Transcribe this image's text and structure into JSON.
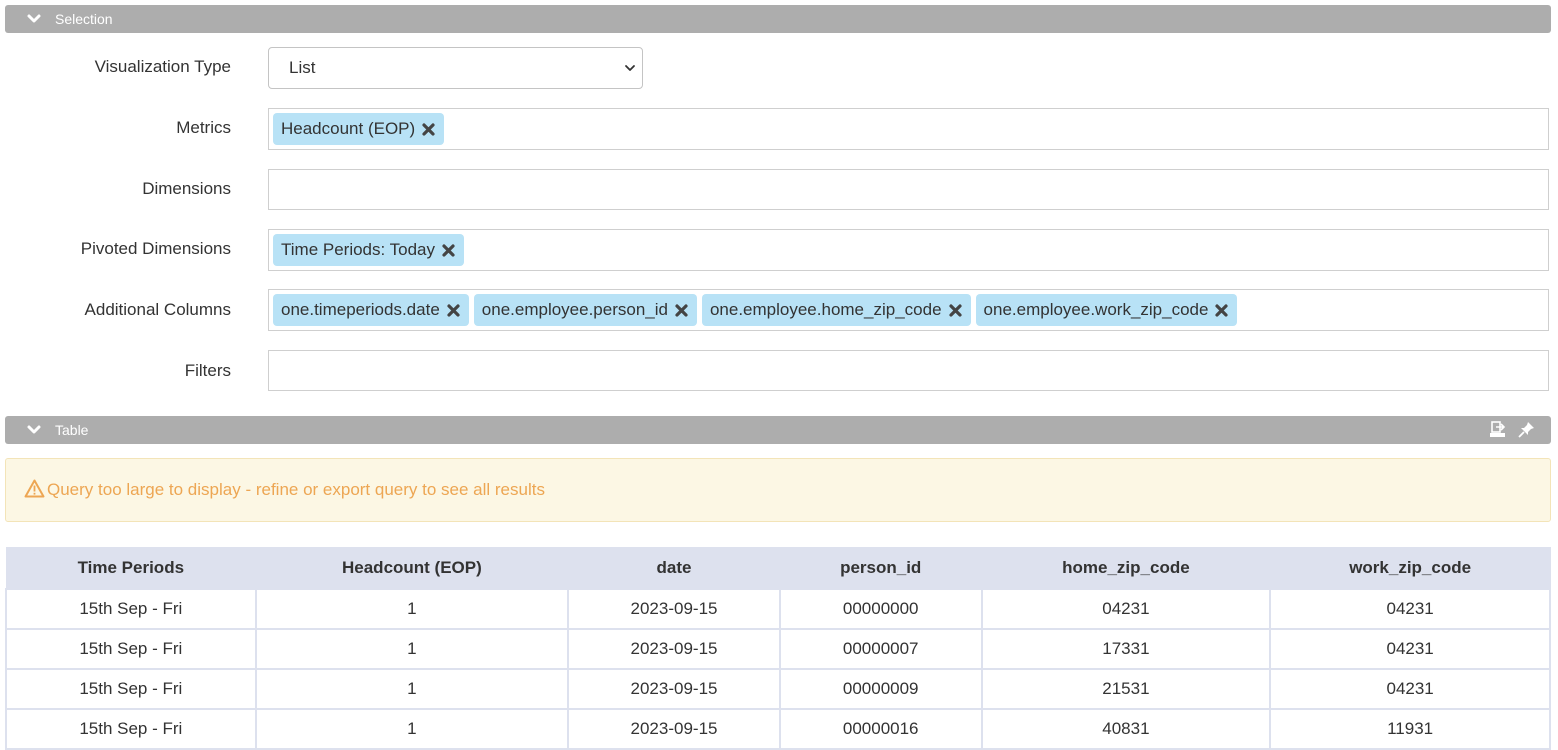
{
  "selection_bar": {
    "title": "Selection"
  },
  "form": {
    "visualization_type": {
      "label": "Visualization Type",
      "value": "List"
    },
    "metrics": {
      "label": "Metrics",
      "tags": [
        "Headcount (EOP)"
      ]
    },
    "dimensions": {
      "label": "Dimensions",
      "tags": []
    },
    "pivoted_dimensions": {
      "label": "Pivoted Dimensions",
      "tags": [
        "Time Periods: Today"
      ]
    },
    "additional_columns": {
      "label": "Additional Columns",
      "tags": [
        "one.timeperiods.date",
        "one.employee.person_id",
        "one.employee.home_zip_code",
        "one.employee.work_zip_code"
      ]
    },
    "filters": {
      "label": "Filters",
      "tags": []
    }
  },
  "table_bar": {
    "title": "Table",
    "icons": [
      "export-icon",
      "pin-icon"
    ]
  },
  "alert": {
    "icon": "warning-icon",
    "text": "Query too large to display - refine or export query to see all results",
    "color": "#eda653"
  },
  "table": {
    "columns": [
      "Time Periods",
      "Headcount (EOP)",
      "date",
      "person_id",
      "home_zip_code",
      "work_zip_code"
    ],
    "rows": [
      [
        "15th Sep - Fri",
        "1",
        "2023-09-15",
        "00000000",
        "04231",
        "04231"
      ],
      [
        "15th Sep - Fri",
        "1",
        "2023-09-15",
        "00000007",
        "17331",
        "04231"
      ],
      [
        "15th Sep - Fri",
        "1",
        "2023-09-15",
        "00000009",
        "21531",
        "04231"
      ],
      [
        "15th Sep - Fri",
        "1",
        "2023-09-15",
        "00000016",
        "40831",
        "11931"
      ]
    ]
  },
  "colors": {
    "bar": "#adadad",
    "tag": "#b8e2f6",
    "header": "#dde1ee"
  }
}
